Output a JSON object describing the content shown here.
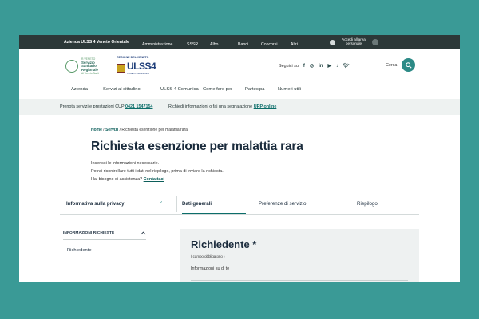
{
  "topbar": {
    "brand": "Azienda ULSS 4 Veneto Orientale",
    "nav": [
      "Amministrazione",
      "SSSR",
      "Albo",
      "Bandi",
      "Concorsi",
      "Altri"
    ],
    "login": "Accedi all'area personale"
  },
  "header": {
    "logo1": {
      "line1": "R.VENETO",
      "line2": "Servizio",
      "line3": "Sanitario",
      "line4": "Regionale",
      "line5": "Al Veneto Sanit"
    },
    "logo2": {
      "top": "REGIONE DEL VENETO",
      "name": "ULSS4",
      "sub": "VENETO ORIENTALE"
    },
    "social_label": "Seguici su",
    "social_icons": [
      "facebook-icon",
      "instagram-icon",
      "linkedin-icon",
      "youtube-icon",
      "tiktok-icon",
      "twitter-icon"
    ],
    "search_label": "Cerca"
  },
  "mainnav": [
    "Azienda",
    "Servizi al cittadino",
    "ULSS 4 Comunica",
    "Come fare per",
    "Partecipa",
    "Numeri utili"
  ],
  "infobar": {
    "text1": "Prenota servizi e prestazioni CUP",
    "cup_phone": "0421 1547154",
    "text2": "Richiedi informazioni o fai una segnalazione",
    "urp_link": "URP online"
  },
  "breadcrumb": {
    "home": "Home",
    "sep": "/",
    "servizi": "Servizi",
    "current": "Richiesta esenzione per malattia rara"
  },
  "page": {
    "title": "Richiesta esenzione per malattia rara",
    "intro1": "Inserisci le informazioni necessarie.",
    "intro2": "Potrai ricontrollare tutti i dati nel riepilogo, prima di inviare la richiesta.",
    "help_text": "Hai bisogno di assistenza?",
    "help_link": "Contattaci"
  },
  "steps": {
    "step1": "Informativa sulla privacy",
    "step2": "Dati generali",
    "step3": "Preferenze di servizio",
    "step4": "Riepilogo"
  },
  "sidebar": {
    "heading": "INFORMAZIONI RICHIESTE",
    "item": "Richiedente"
  },
  "panel": {
    "title": "Richiedente *",
    "required": "( campo obbligatorio )",
    "info": "Informazioni su di te"
  },
  "colors": {
    "background": "#3a9a96",
    "topbar": "#2c3838",
    "accent": "#0c6e6a"
  }
}
